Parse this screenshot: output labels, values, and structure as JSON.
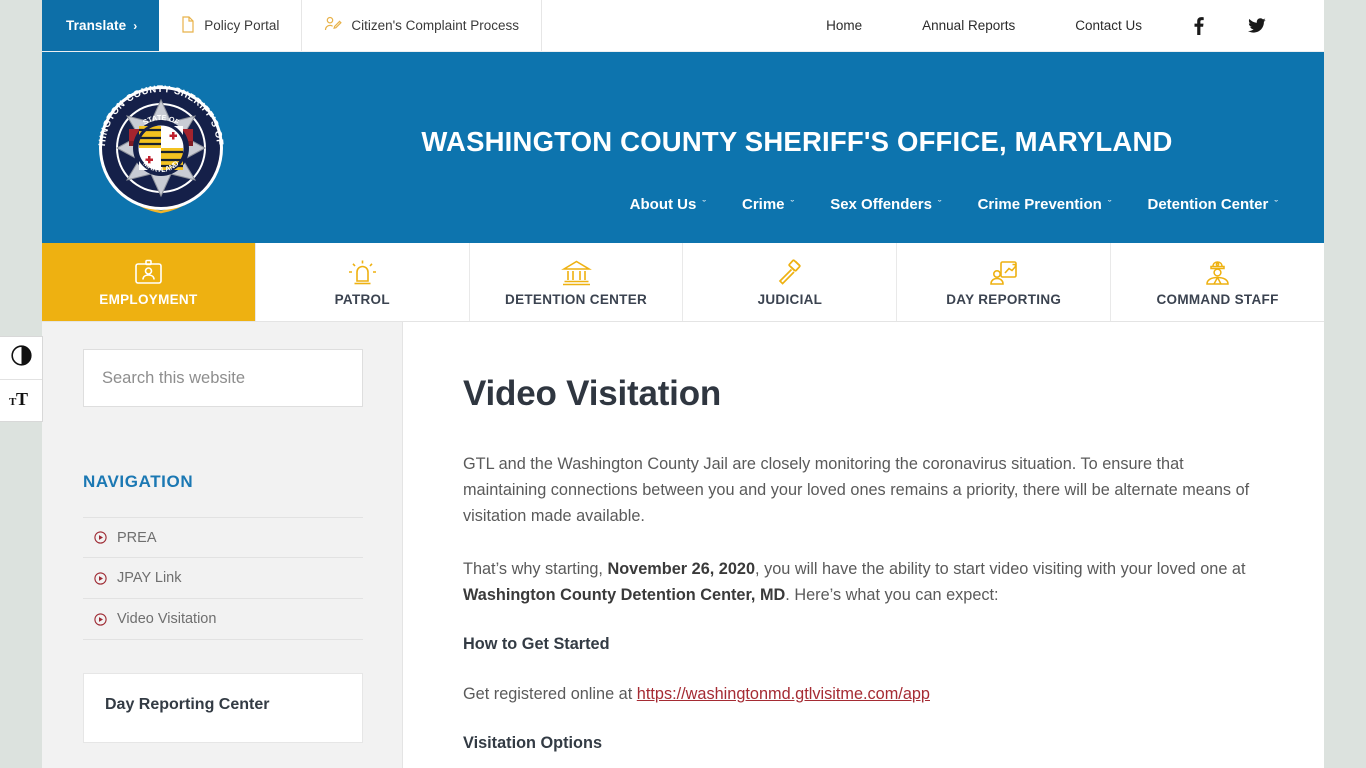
{
  "utility_bar": {
    "translate": {
      "label": "Translate",
      "chevron": "›"
    },
    "links": [
      {
        "label": "Policy Portal",
        "icon": "document-icon"
      },
      {
        "label": "Citizen's Complaint Process",
        "icon": "user-edit-icon"
      }
    ],
    "right_links": [
      "Home",
      "Annual Reports",
      "Contact Us"
    ],
    "social": [
      {
        "name": "facebook-icon",
        "glyph": "f"
      },
      {
        "name": "twitter-icon",
        "glyph": "t"
      }
    ]
  },
  "header": {
    "title": "WASHINGTON COUNTY SHERIFF'S OFFICE, MARYLAND",
    "badge": {
      "outer_text_top": "WASHINGTON COUNTY SHERIFF'S OFFICE",
      "inner_text_top": "STATE OF",
      "inner_text_bottom": "MARYLAND"
    },
    "nav": [
      {
        "label": "About Us",
        "caret": "ˇ"
      },
      {
        "label": "Crime",
        "caret": "ˇ"
      },
      {
        "label": "Sex Offenders",
        "caret": "ˇ"
      },
      {
        "label": "Crime Prevention",
        "caret": "ˇ"
      },
      {
        "label": "Detention Center",
        "caret": "ˇ"
      }
    ],
    "background_color": "#0d74ae"
  },
  "tab_strip": {
    "active_color": "#eeb111",
    "tabs": [
      {
        "label": "EMPLOYMENT",
        "icon": "id-badge-icon",
        "active": true
      },
      {
        "label": "PATROL",
        "icon": "siren-light-icon",
        "active": false
      },
      {
        "label": "DETENTION CENTER",
        "icon": "courthouse-icon",
        "active": false
      },
      {
        "label": "JUDICIAL",
        "icon": "gavel-icon",
        "active": false
      },
      {
        "label": "DAY REPORTING",
        "icon": "person-chart-icon",
        "active": false
      },
      {
        "label": "COMMAND STAFF",
        "icon": "officer-icon",
        "active": false
      }
    ]
  },
  "accessibility": {
    "contrast_toggle": "contrast-icon",
    "font_size_toggle": "text-size-icon"
  },
  "sidebar": {
    "search": {
      "placeholder": "Search this website",
      "value": ""
    },
    "navigation_heading": "NAVIGATION",
    "nav_items": [
      {
        "label": "PREA",
        "bullet": "play-circle-icon"
      },
      {
        "label": "JPAY Link",
        "bullet": "play-circle-icon"
      },
      {
        "label": "Video Visitation",
        "bullet": "play-circle-icon"
      }
    ],
    "widget": {
      "title": "Day Reporting Center"
    }
  },
  "main": {
    "page_title": "Video Visitation",
    "paragraph_1": "GTL and the Washington County Jail are closely monitoring the coronavirus situation. To ensure that maintaining connections between you and your loved ones remains a priority, there will be alternate means of visitation made available.",
    "paragraph_2": {
      "prefix": "That’s why starting, ",
      "bold_1": "November 26, 2020",
      "middle": ", you will have the ability to start video visiting with your loved one at ",
      "bold_2": "Washington County Detention Center, MD",
      "suffix": ". Here’s what you can expect:"
    },
    "subhead_1": "How to Get Started",
    "paragraph_3": {
      "prefix": "Get registered online at ",
      "link_text": "https://washingtonmd.gtlvisitme.com/app"
    },
    "subhead_2": " Visitation Options"
  },
  "colors": {
    "brand_blue": "#0d74ae",
    "accent_gold": "#eeb111",
    "link_red": "#a52b33",
    "page_background": "#dce2de",
    "sidebar_background": "#f2f2f2"
  }
}
